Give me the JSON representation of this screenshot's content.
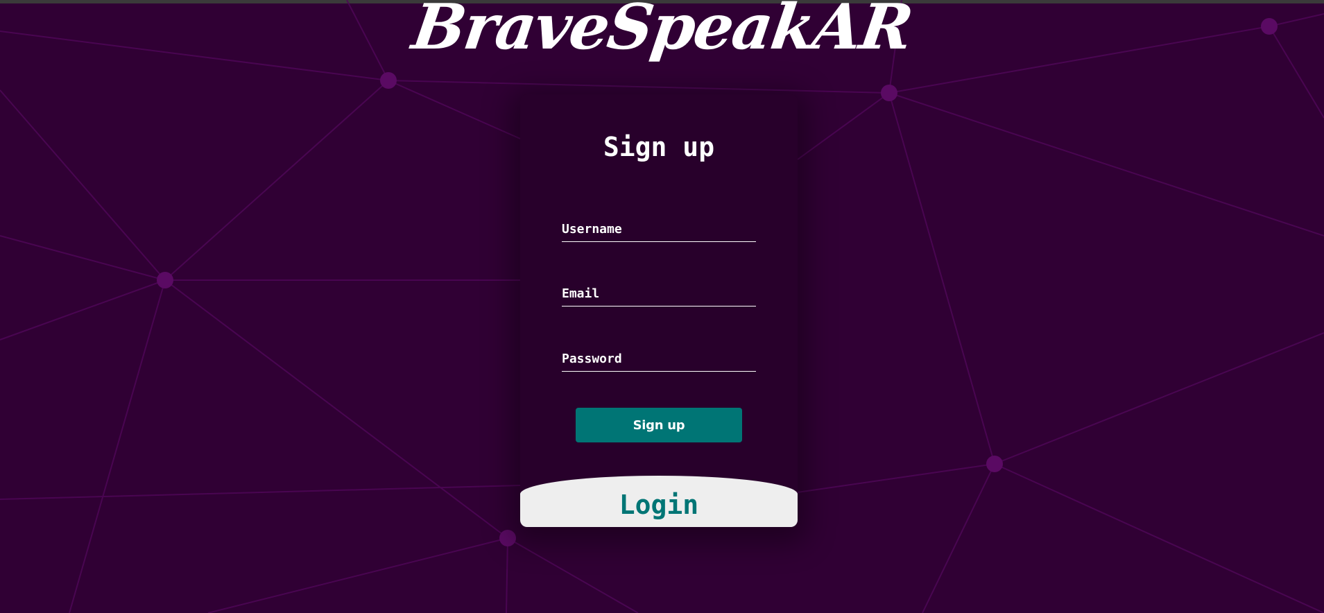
{
  "brand": {
    "title": "BraveSpeakAR"
  },
  "signup_form": {
    "title": "Sign up",
    "fields": {
      "username": {
        "placeholder": "Username",
        "value": ""
      },
      "email": {
        "placeholder": "Email",
        "value": ""
      },
      "password": {
        "placeholder": "Password",
        "value": ""
      }
    },
    "submit_label": "Sign up"
  },
  "login_panel": {
    "label": "Login"
  },
  "colors": {
    "background": "#300034",
    "card_background": "#28002b",
    "accent": "#007575",
    "network_lines": "#5a0a63",
    "login_panel": "#eeeeee",
    "text": "#ffffff"
  }
}
